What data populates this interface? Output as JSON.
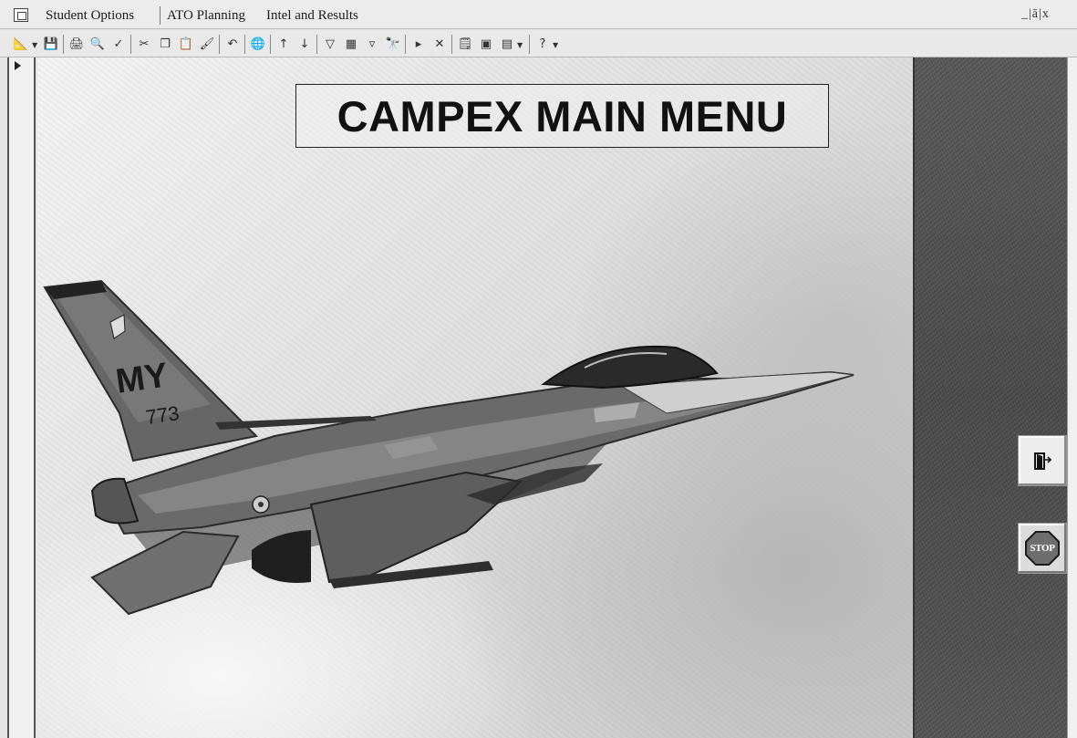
{
  "menubar": {
    "items": [
      {
        "label": "Student Options"
      },
      {
        "label": "ATO Planning"
      },
      {
        "label": "Intel and Results"
      }
    ],
    "window_controls": "_|ā|x"
  },
  "toolbar": {
    "buttons": [
      "design-view-icon",
      "save-icon",
      "print-icon",
      "print-preview-icon",
      "spelling-icon",
      "cut-icon",
      "copy-icon",
      "paste-icon",
      "format-painter-icon",
      "undo-icon",
      "insert-hyperlink-icon",
      "sort-ascending-icon",
      "sort-descending-icon",
      "filter-by-selection-icon",
      "filter-by-form-icon",
      "apply-filter-icon",
      "find-icon",
      "new-record-icon",
      "delete-record-icon",
      "properties-icon",
      "database-window-icon",
      "new-object-icon",
      "help-icon"
    ]
  },
  "main": {
    "title": "CAMPEX MAIN MENU",
    "photo": {
      "subject": "F-16 fighter jet in flight",
      "tail_code": "MY",
      "tail_number": "773"
    }
  },
  "side": {
    "exit_icon": "exit-door-icon",
    "stop_label": "STOP"
  },
  "colors": {
    "menubar_bg": "#ececec",
    "side_panel_bg": "#525252",
    "photo_bg": "#e2e2e2"
  }
}
